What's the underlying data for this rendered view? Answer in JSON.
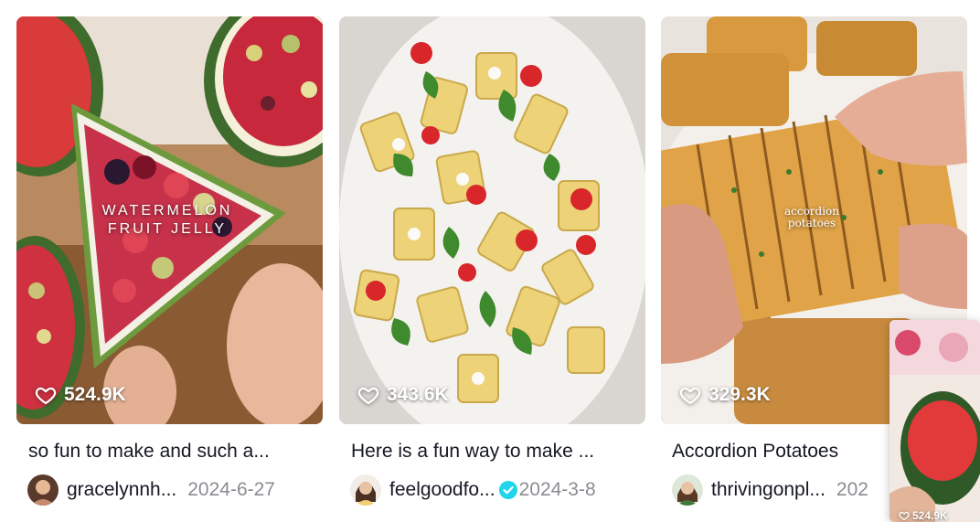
{
  "videos": [
    {
      "likes": "524.9K",
      "overlay_line1": "WATERMELON",
      "overlay_line2": "FRUIT JELLY",
      "description": "so fun to make and such a...",
      "username": "gracelynnh...",
      "date": "2024-6-27",
      "verified": false
    },
    {
      "likes": "343.6K",
      "description": "Here is a fun way to make ...",
      "username": "feelgoodfo...",
      "date": "2024-3-8",
      "verified": true
    },
    {
      "likes": "329.3K",
      "overlay_line1": "accordion",
      "overlay_line2": "potatoes",
      "description": "Accordion Potatoes",
      "username": "thrivingonpl...",
      "date": "202",
      "verified": false
    }
  ],
  "mini_player": {
    "likes": "524.9K"
  },
  "colors": {
    "verified_badge": "#20d5ec",
    "date_text": "rgba(22,24,35,0.5)"
  },
  "icons": {
    "like": "heart-outline-icon",
    "verified": "verified-check-icon"
  }
}
